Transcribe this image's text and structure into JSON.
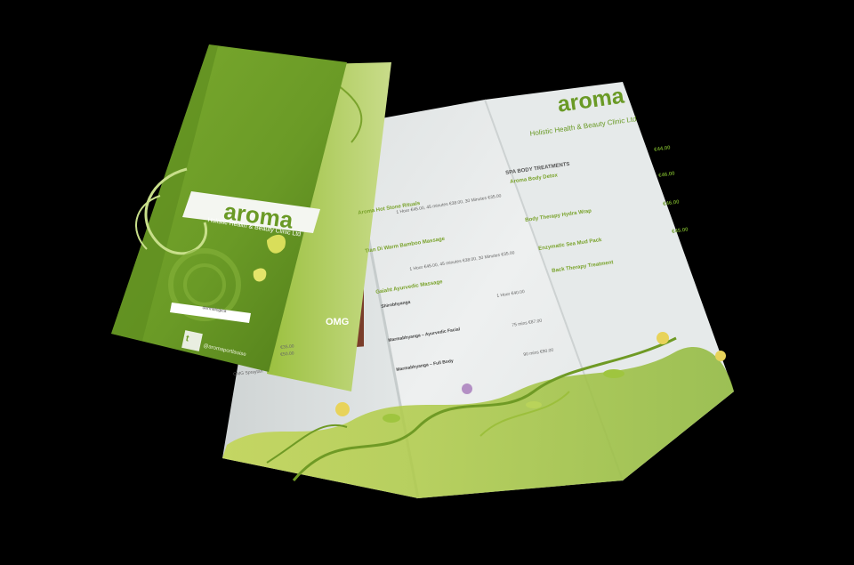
{
  "brand": {
    "name": "aroma",
    "tagline": "Holistic Health & Beauty Clinic Ltd",
    "social": "@aromaportlaoise",
    "social_icon": "twitter-icon",
    "partner_logo": "dermalogica"
  },
  "colors": {
    "background": "#000000",
    "brand_green": "#6e9e2a",
    "brand_green_dark": "#4f7a1a",
    "accent_green": "#8fb83a",
    "paper": "#e9ecec"
  },
  "middle_panel": {
    "treatments": [
      {
        "name": "Aroma Hot Stone Rituals",
        "price": "1 Hour €45.00, 45 minutes €38.00, 30 Minutes €35.00"
      },
      {
        "name": "Tian Di Warm Bamboo Massage",
        "price": "1 Hour €45.00, 45 minutes €38.00, 30 Minutes €35.00"
      },
      {
        "name": "Gaiaht Ayurvedic Massage",
        "price": "1 Hour €40.00"
      },
      {
        "name": "Shirobhyanga",
        "price": ""
      },
      {
        "name": "Marmabhyanga – Ayurvedic Facial",
        "price": "75 mins €87.00"
      },
      {
        "name": "Marmabhyanga – Full Body",
        "price": "90 mins €90.00"
      }
    ]
  },
  "left_panel": {
    "prices": [
      "€35.00",
      "€50.00"
    ],
    "partial_item": "OMG Spraytan"
  },
  "right_panel": {
    "section_title": "SPA BODY TREATMENTS",
    "treatments": [
      {
        "name": "Aroma Body Detox",
        "price": "€44.00"
      },
      {
        "name": "Body Therapy Hydra Wrap",
        "price": "€46.00"
      },
      {
        "name": "Enzymatic Sea Mud Pack",
        "price": "€46.00"
      },
      {
        "name": "Back Therapy Treatment",
        "price": "€45.00"
      }
    ]
  },
  "photo_badge": "OMG"
}
